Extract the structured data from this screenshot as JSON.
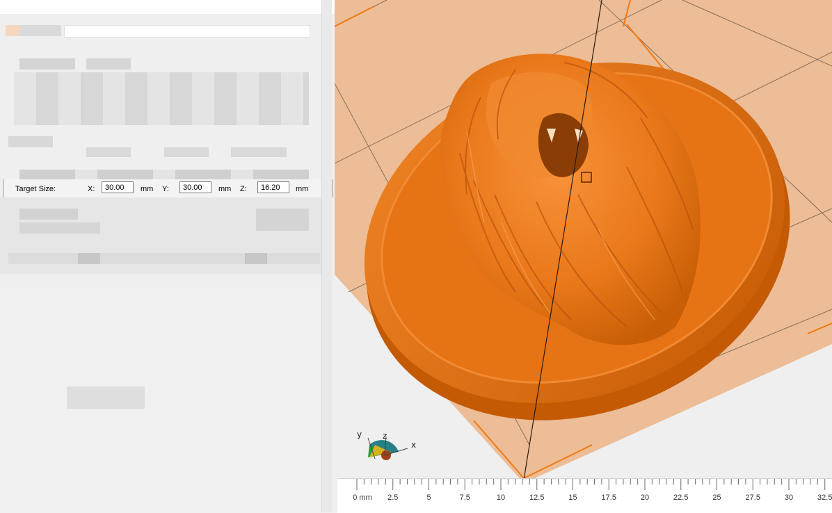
{
  "left_panel": {
    "target_size": {
      "label": "Target Size:",
      "x_label": "X:",
      "x_value": "30.00",
      "x_unit": "mm",
      "y_label": "Y:",
      "y_value": "30.00",
      "y_unit": "mm",
      "z_label": "Z:",
      "z_value": "16.20",
      "z_unit": "mm"
    }
  },
  "viewport": {
    "model_color": "#e8760e",
    "bed_color": "#ecbd96",
    "bed_line_color": "#f07a12",
    "axis_gizmo": {
      "x_label": "x",
      "y_label": "y",
      "z_label": "z"
    }
  },
  "ruler": {
    "ticks": [
      "0 mm",
      "2.5",
      "5",
      "7.5",
      "10",
      "12.5",
      "15",
      "17.5",
      "20",
      "22.5",
      "25",
      "27.5",
      "30",
      "32.5"
    ]
  }
}
